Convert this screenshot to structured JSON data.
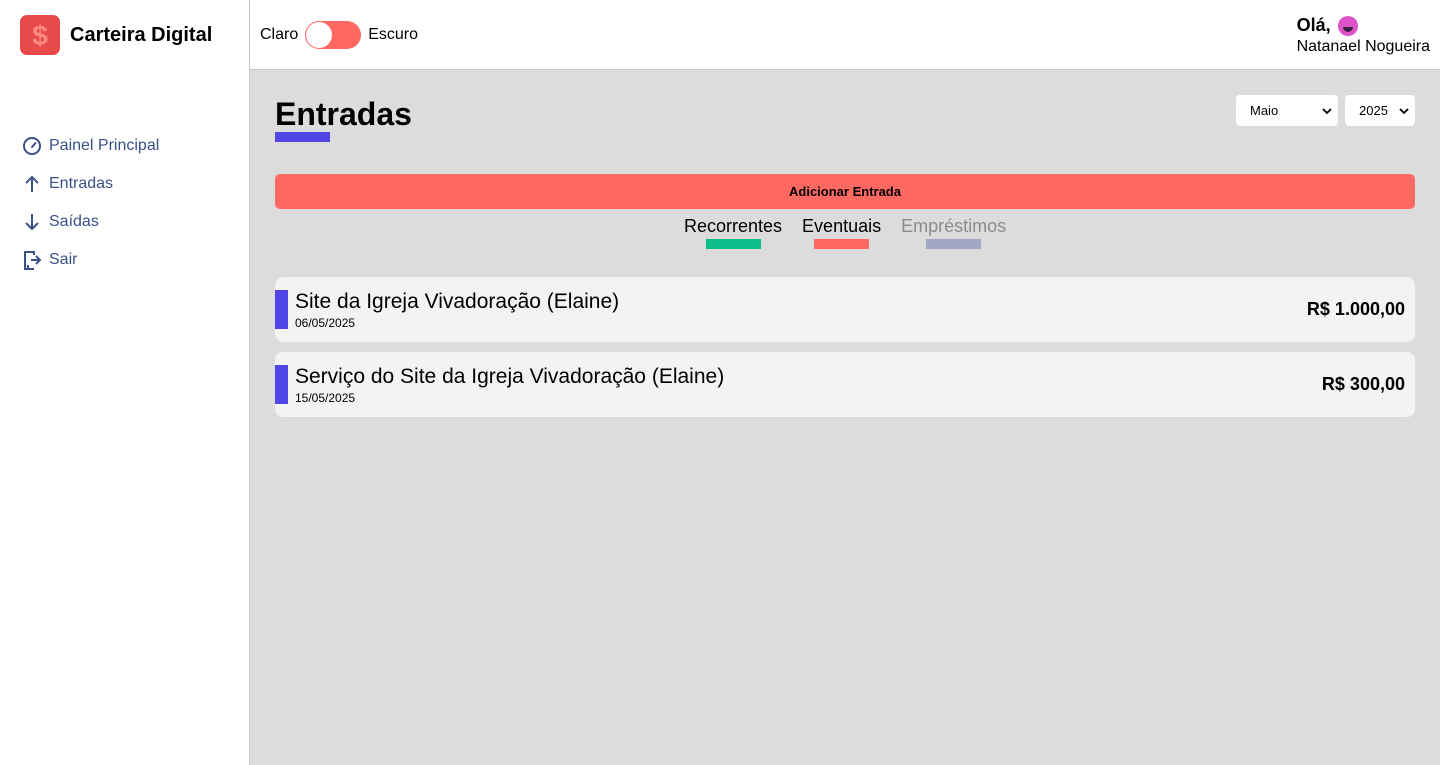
{
  "brand": {
    "name": "Carteira Digital",
    "logo_icon": "dollar-icon",
    "logo_color": "#e84a4a"
  },
  "menu": [
    {
      "label": "Painel Principal",
      "icon": "dashboard-icon"
    },
    {
      "label": "Entradas",
      "icon": "arrow-up-icon"
    },
    {
      "label": "Saídas",
      "icon": "arrow-down-icon"
    },
    {
      "label": "Sair",
      "icon": "logout-icon"
    }
  ],
  "theme": {
    "light_label": "Claro",
    "dark_label": "Escuro",
    "toggle_color": "#ff6961",
    "is_dark": false
  },
  "user": {
    "greeting": "Olá,",
    "name": "Natanael Nogueira",
    "emoji_icon": "star-struck-emoji"
  },
  "page": {
    "title": "Entradas",
    "accent": "#4f46e5"
  },
  "filters_select": {
    "month": "Maio",
    "year": "2025"
  },
  "add_button": {
    "label": "Adicionar Entrada",
    "color": "#ff6961"
  },
  "frequency_tabs": [
    {
      "label": "Recorrentes",
      "color": "#0ebd8a"
    },
    {
      "label": "Eventuais",
      "color": "#ff6961"
    },
    {
      "label": "Empréstimos",
      "color": "#a0a8c4"
    }
  ],
  "entries": [
    {
      "description": "Site da Igreja Vivadoração (Elaine)",
      "date": "06/05/2025",
      "amount": "R$ 1.000,00",
      "tag_color": "#4f46e5"
    },
    {
      "description": "Serviço do Site da Igreja Vivadoração (Elaine)",
      "date": "15/05/2025",
      "amount": "R$ 300,00",
      "tag_color": "#4f46e5"
    }
  ]
}
